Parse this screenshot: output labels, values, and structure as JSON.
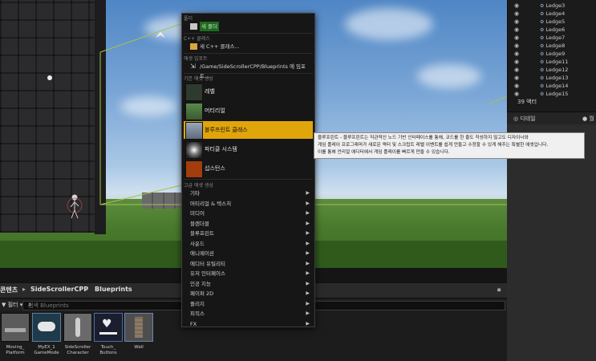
{
  "menu": {
    "folder_section": "폴더",
    "new_folder": "새 폴더",
    "cpp_section": "C++ 클래스",
    "new_cpp_class": "새 C++ 클래스...",
    "import_section": "애셋 임포트",
    "import_path": "/Game/SideScrollerCPP/Blueprints 에 임포트...",
    "basic_section": "기본 애셋 생성",
    "basic_items": [
      "레벨",
      "머티리얼",
      "블루프린트 클래스",
      "파티클 시스템",
      "섭스턴스"
    ],
    "selected_item": "블루프린트 클래스",
    "advanced_section": "고급 애셋 생성",
    "advanced_items": [
      "기타",
      "머티리얼 & 텍스처",
      "미디어",
      "블렌더블",
      "블루프린트",
      "사운드",
      "애니메이션",
      "에디터 유틸리티",
      "유저 인터페이스",
      "인공 지능",
      "페이퍼 2D",
      "플리지",
      "피직스",
      "FX"
    ]
  },
  "tooltip": {
    "line1": "블루프린트 - 블루프린트는 직관적인 노드 기반 인터페이스를 통해, 코드를 한 줄도 작성하지 않고도 디자이너와",
    "line2": "게임 플레이 프로그래머가 새로운 액터 및 스크립트 레벨 이벤트를 쉽게 만들고 수정할 수 있게 해주는 특별한 애셋입니다.",
    "line3": "이를 통해 언리얼 에디터에서 게임 플레이를 빠르게 만들 수 있습니다."
  },
  "outliner": {
    "items": [
      "Ledge3",
      "Ledge4",
      "Ledge5",
      "Ledge6",
      "Ledge7",
      "Ledge8",
      "Ledge9",
      "Ledge11",
      "Ledge12",
      "Ledge13",
      "Ledge14",
      "Ledge15"
    ],
    "actor_count": "39 액터"
  },
  "details": {
    "tab1": "디테일",
    "tab2": "월"
  },
  "content_browser": {
    "breadcrumb_root": "콘텐츠",
    "breadcrumb_1": "SideScrollerCPP",
    "breadcrumb_2": "Blueprints",
    "filter_label": "필터",
    "search_placeholder": "검색 Blueprints",
    "assets": [
      {
        "line1": "Moving_",
        "line2": "Platform"
      },
      {
        "line1": "MyEX_1",
        "line2": "GameMode"
      },
      {
        "line1": "SideScroller",
        "line2": "Character"
      },
      {
        "line1": "Touch_",
        "line2": "Buttons"
      },
      {
        "line1": "Wall",
        "line2": ""
      }
    ]
  },
  "colors": {
    "accent_selected": "#e1a50c",
    "menu_bg": "#161616"
  }
}
